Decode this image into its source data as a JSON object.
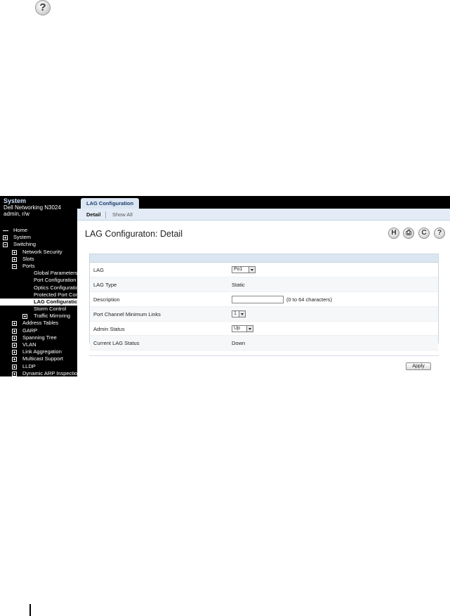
{
  "help_icon": {
    "glyph": "?",
    "icon": "help-icon"
  },
  "sidebar": {
    "title": "System",
    "device": "Dell Networking N3024",
    "user": "admin, r/w",
    "items": [
      {
        "label": "Home",
        "level": 0,
        "box": "none"
      },
      {
        "label": "System",
        "level": 0,
        "box": "plus"
      },
      {
        "label": "Switching",
        "level": 0,
        "box": "minus"
      },
      {
        "label": "Network Security",
        "level": 1,
        "box": "plus"
      },
      {
        "label": "Slots",
        "level": 1,
        "box": "plus"
      },
      {
        "label": "Ports",
        "level": 1,
        "box": "minus"
      },
      {
        "label": "Global Parameters",
        "level": 2,
        "box": "none"
      },
      {
        "label": "Port Configuration",
        "level": 2,
        "box": "none"
      },
      {
        "label": "Optics Configuration",
        "level": 2,
        "box": "none"
      },
      {
        "label": "Protected Port Conf",
        "level": 2,
        "box": "none"
      },
      {
        "label": "LAG Configuratic",
        "level": 2,
        "box": "none",
        "selected": true
      },
      {
        "label": "Storm Control",
        "level": 2,
        "box": "none"
      },
      {
        "label": "Traffic Mirroring",
        "level": 2,
        "box": "plus"
      },
      {
        "label": "Address Tables",
        "level": 1,
        "box": "plus"
      },
      {
        "label": "GARP",
        "level": 1,
        "box": "plus"
      },
      {
        "label": "Spanning Tree",
        "level": 1,
        "box": "plus"
      },
      {
        "label": "VLAN",
        "level": 1,
        "box": "plus"
      },
      {
        "label": "Link Aggregation",
        "level": 1,
        "box": "plus"
      },
      {
        "label": "Multicast Support",
        "level": 1,
        "box": "plus"
      },
      {
        "label": "LLDP",
        "level": 1,
        "box": "plus"
      },
      {
        "label": "Dynamic ARP Inspection",
        "level": 1,
        "box": "plus"
      }
    ]
  },
  "tabs": {
    "active": "LAG Configuration"
  },
  "subtabs": {
    "detail": "Detail",
    "show_all": "Show All"
  },
  "page": {
    "title": "LAG Configuraton: Detail",
    "toolbar": {
      "save": "H",
      "print": "⎙",
      "refresh": "C",
      "help": "?"
    }
  },
  "form": {
    "lag_label": "LAG",
    "lag_value": "Po1",
    "lag_type_label": "LAG Type",
    "lag_type_value": "Static",
    "description_label": "Description",
    "description_value": "",
    "description_hint": "(0 to 64 characters)",
    "min_links_label": "Port Channel Minimum Links",
    "min_links_value": "1",
    "admin_status_label": "Admin Status",
    "admin_status_value": "Up",
    "current_status_label": "Current LAG Status",
    "current_status_value": "Down"
  },
  "apply_label": "Apply"
}
